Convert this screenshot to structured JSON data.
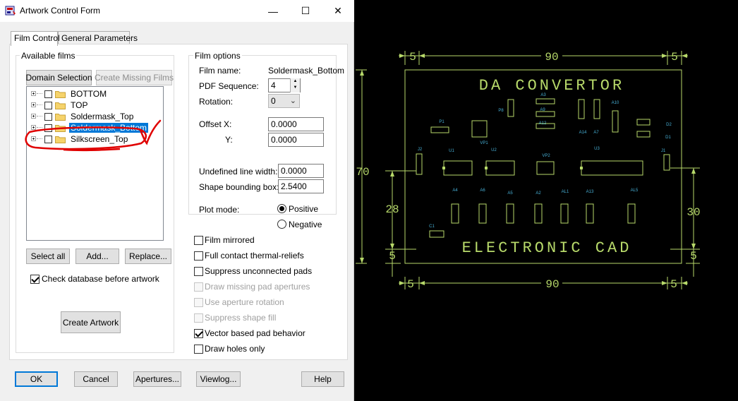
{
  "window": {
    "title": "Artwork Control Form",
    "minimize_glyph": "—",
    "maximize_glyph": "☐",
    "close_glyph": "✕"
  },
  "tabs": [
    {
      "label": "Film Control",
      "active": true
    },
    {
      "label": "General Parameters",
      "active": false
    }
  ],
  "available_films": {
    "title": "Available films",
    "domain_selection": "Domain Selection",
    "create_missing_films": "Create Missing Films",
    "films": [
      {
        "name": "BOTTOM",
        "selected": false
      },
      {
        "name": "TOP",
        "selected": false
      },
      {
        "name": "Soldermask_Top",
        "selected": false
      },
      {
        "name": "Soldermask_Bottom",
        "selected": true
      },
      {
        "name": "Silkscreen_Top",
        "selected": false
      }
    ],
    "select_all": "Select all",
    "add": "Add...",
    "replace": "Replace...",
    "check_database_label": "Check database before artwork",
    "check_database_checked": true,
    "create_artwork": "Create Artwork"
  },
  "film_options": {
    "title": "Film options",
    "film_name_label": "Film name:",
    "film_name_value": "Soldermask_Bottom",
    "pdf_sequence_label": "PDF Sequence:",
    "pdf_sequence_value": "4",
    "rotation_label": "Rotation:",
    "rotation_value": "0",
    "offset_label": "Offset",
    "offset_x_label": "X:",
    "offset_x_value": "0.0000",
    "offset_y_label": "Y:",
    "offset_y_value": "0.0000",
    "undefined_line_width_label": "Undefined line width:",
    "undefined_line_width_value": "0.0000",
    "shape_bounding_box_label": "Shape bounding box:",
    "shape_bounding_box_value": "2.5400",
    "plot_mode_label": "Plot mode:",
    "plot_mode_positive": "Positive",
    "plot_mode_negative": "Negative",
    "plot_mode_selected": "Positive",
    "options": [
      {
        "label": "Film mirrored",
        "checked": false,
        "enabled": true
      },
      {
        "label": "Full contact thermal-reliefs",
        "checked": false,
        "enabled": true
      },
      {
        "label": "Suppress unconnected pads",
        "checked": false,
        "enabled": true
      },
      {
        "label": "Draw missing pad apertures",
        "checked": false,
        "enabled": false
      },
      {
        "label": "Use aperture rotation",
        "checked": false,
        "enabled": false
      },
      {
        "label": "Suppress shape fill",
        "checked": false,
        "enabled": false
      },
      {
        "label": "Vector based pad behavior",
        "checked": true,
        "enabled": true
      },
      {
        "label": "Draw holes only",
        "checked": false,
        "enabled": true
      }
    ]
  },
  "footer": {
    "ok": "OK",
    "cancel": "Cancel",
    "apertures": "Apertures...",
    "viewlog": "Viewlog...",
    "help": "Help"
  },
  "cad": {
    "colors": {
      "outline": "#b7d96a",
      "ref": "#47b0d6",
      "annotation": "#e00000"
    },
    "title_text": "DA CONVERTOR",
    "bottom_text": "ELECTRONIC CAD",
    "dims": {
      "top": "90",
      "bottom": "90",
      "top_left": "5",
      "top_right": "5",
      "bottom_left": "5",
      "bottom_right": "5",
      "left_height": "70",
      "left_mid": "28",
      "left_small": "5",
      "right_mid": "30",
      "right_small": "5"
    },
    "refs": [
      "A3",
      "P8",
      "A9",
      "A10",
      "A12",
      "P1",
      "VP1",
      "A14",
      "A7",
      "D2",
      "D1",
      "J2",
      "U1",
      "U2",
      "VP2",
      "U3",
      "J1",
      "A4",
      "A6",
      "A5",
      "A2",
      "AL1",
      "A13",
      "AL5",
      "C1"
    ]
  }
}
